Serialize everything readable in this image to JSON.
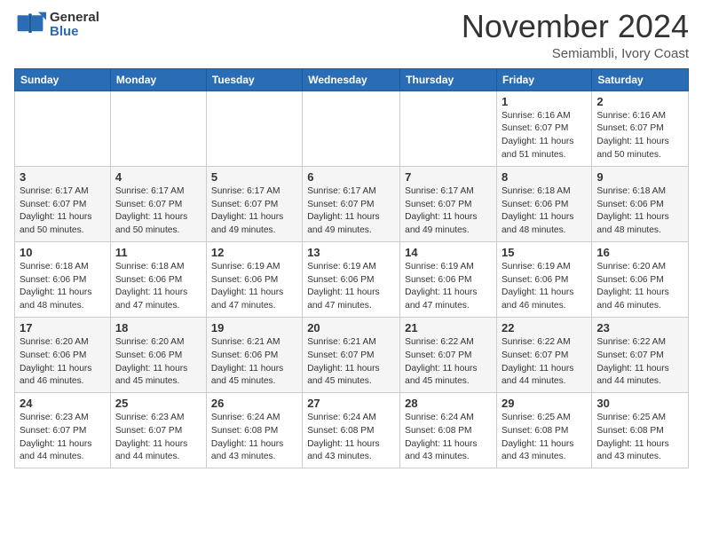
{
  "header": {
    "logo_general": "General",
    "logo_blue": "Blue",
    "month_title": "November 2024",
    "location": "Semiambli, Ivory Coast"
  },
  "days_of_week": [
    "Sunday",
    "Monday",
    "Tuesday",
    "Wednesday",
    "Thursday",
    "Friday",
    "Saturday"
  ],
  "weeks": [
    [
      {
        "day": "",
        "info": ""
      },
      {
        "day": "",
        "info": ""
      },
      {
        "day": "",
        "info": ""
      },
      {
        "day": "",
        "info": ""
      },
      {
        "day": "",
        "info": ""
      },
      {
        "day": "1",
        "info": "Sunrise: 6:16 AM\nSunset: 6:07 PM\nDaylight: 11 hours and 51 minutes."
      },
      {
        "day": "2",
        "info": "Sunrise: 6:16 AM\nSunset: 6:07 PM\nDaylight: 11 hours and 50 minutes."
      }
    ],
    [
      {
        "day": "3",
        "info": "Sunrise: 6:17 AM\nSunset: 6:07 PM\nDaylight: 11 hours and 50 minutes."
      },
      {
        "day": "4",
        "info": "Sunrise: 6:17 AM\nSunset: 6:07 PM\nDaylight: 11 hours and 50 minutes."
      },
      {
        "day": "5",
        "info": "Sunrise: 6:17 AM\nSunset: 6:07 PM\nDaylight: 11 hours and 49 minutes."
      },
      {
        "day": "6",
        "info": "Sunrise: 6:17 AM\nSunset: 6:07 PM\nDaylight: 11 hours and 49 minutes."
      },
      {
        "day": "7",
        "info": "Sunrise: 6:17 AM\nSunset: 6:07 PM\nDaylight: 11 hours and 49 minutes."
      },
      {
        "day": "8",
        "info": "Sunrise: 6:18 AM\nSunset: 6:06 PM\nDaylight: 11 hours and 48 minutes."
      },
      {
        "day": "9",
        "info": "Sunrise: 6:18 AM\nSunset: 6:06 PM\nDaylight: 11 hours and 48 minutes."
      }
    ],
    [
      {
        "day": "10",
        "info": "Sunrise: 6:18 AM\nSunset: 6:06 PM\nDaylight: 11 hours and 48 minutes."
      },
      {
        "day": "11",
        "info": "Sunrise: 6:18 AM\nSunset: 6:06 PM\nDaylight: 11 hours and 47 minutes."
      },
      {
        "day": "12",
        "info": "Sunrise: 6:19 AM\nSunset: 6:06 PM\nDaylight: 11 hours and 47 minutes."
      },
      {
        "day": "13",
        "info": "Sunrise: 6:19 AM\nSunset: 6:06 PM\nDaylight: 11 hours and 47 minutes."
      },
      {
        "day": "14",
        "info": "Sunrise: 6:19 AM\nSunset: 6:06 PM\nDaylight: 11 hours and 47 minutes."
      },
      {
        "day": "15",
        "info": "Sunrise: 6:19 AM\nSunset: 6:06 PM\nDaylight: 11 hours and 46 minutes."
      },
      {
        "day": "16",
        "info": "Sunrise: 6:20 AM\nSunset: 6:06 PM\nDaylight: 11 hours and 46 minutes."
      }
    ],
    [
      {
        "day": "17",
        "info": "Sunrise: 6:20 AM\nSunset: 6:06 PM\nDaylight: 11 hours and 46 minutes."
      },
      {
        "day": "18",
        "info": "Sunrise: 6:20 AM\nSunset: 6:06 PM\nDaylight: 11 hours and 45 minutes."
      },
      {
        "day": "19",
        "info": "Sunrise: 6:21 AM\nSunset: 6:06 PM\nDaylight: 11 hours and 45 minutes."
      },
      {
        "day": "20",
        "info": "Sunrise: 6:21 AM\nSunset: 6:07 PM\nDaylight: 11 hours and 45 minutes."
      },
      {
        "day": "21",
        "info": "Sunrise: 6:22 AM\nSunset: 6:07 PM\nDaylight: 11 hours and 45 minutes."
      },
      {
        "day": "22",
        "info": "Sunrise: 6:22 AM\nSunset: 6:07 PM\nDaylight: 11 hours and 44 minutes."
      },
      {
        "day": "23",
        "info": "Sunrise: 6:22 AM\nSunset: 6:07 PM\nDaylight: 11 hours and 44 minutes."
      }
    ],
    [
      {
        "day": "24",
        "info": "Sunrise: 6:23 AM\nSunset: 6:07 PM\nDaylight: 11 hours and 44 minutes."
      },
      {
        "day": "25",
        "info": "Sunrise: 6:23 AM\nSunset: 6:07 PM\nDaylight: 11 hours and 44 minutes."
      },
      {
        "day": "26",
        "info": "Sunrise: 6:24 AM\nSunset: 6:08 PM\nDaylight: 11 hours and 43 minutes."
      },
      {
        "day": "27",
        "info": "Sunrise: 6:24 AM\nSunset: 6:08 PM\nDaylight: 11 hours and 43 minutes."
      },
      {
        "day": "28",
        "info": "Sunrise: 6:24 AM\nSunset: 6:08 PM\nDaylight: 11 hours and 43 minutes."
      },
      {
        "day": "29",
        "info": "Sunrise: 6:25 AM\nSunset: 6:08 PM\nDaylight: 11 hours and 43 minutes."
      },
      {
        "day": "30",
        "info": "Sunrise: 6:25 AM\nSunset: 6:08 PM\nDaylight: 11 hours and 43 minutes."
      }
    ]
  ]
}
